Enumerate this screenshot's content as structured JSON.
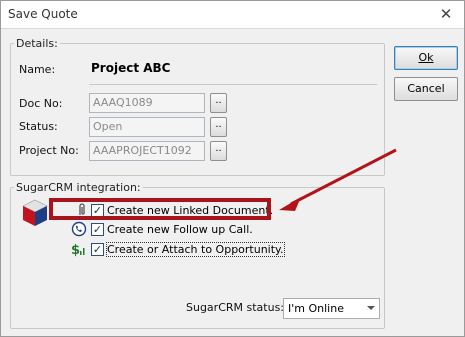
{
  "window": {
    "title": "Save Quote",
    "close_glyph": "✕"
  },
  "details": {
    "legend": "Details:",
    "name_label": "Name:",
    "name_value": "Project ABC",
    "doc_no_label": "Doc No:",
    "doc_no_value": "AAAQ1089",
    "status_label": "Status:",
    "status_value": "Open",
    "project_no_label": "Project No:",
    "project_no_value": "AAAPROJECT1092",
    "browse_label": ".."
  },
  "buttons": {
    "ok": "Ok",
    "cancel": "Cancel"
  },
  "sugar": {
    "legend": "SugarCRM integration:",
    "options": [
      {
        "label": "Create new Linked Document.",
        "checked": true,
        "icon": "paperclip-icon"
      },
      {
        "label": "Create new Follow up Call.",
        "checked": true,
        "icon": "phone-icon"
      },
      {
        "label": "Create or Attach to Opportunity.",
        "checked": true,
        "icon": "dollar-icon"
      }
    ],
    "status_label": "SugarCRM status:",
    "status_value": "I'm Online",
    "check_glyph": "✓"
  },
  "colors": {
    "highlight": "#a8141b",
    "arrow": "#b3121a"
  }
}
